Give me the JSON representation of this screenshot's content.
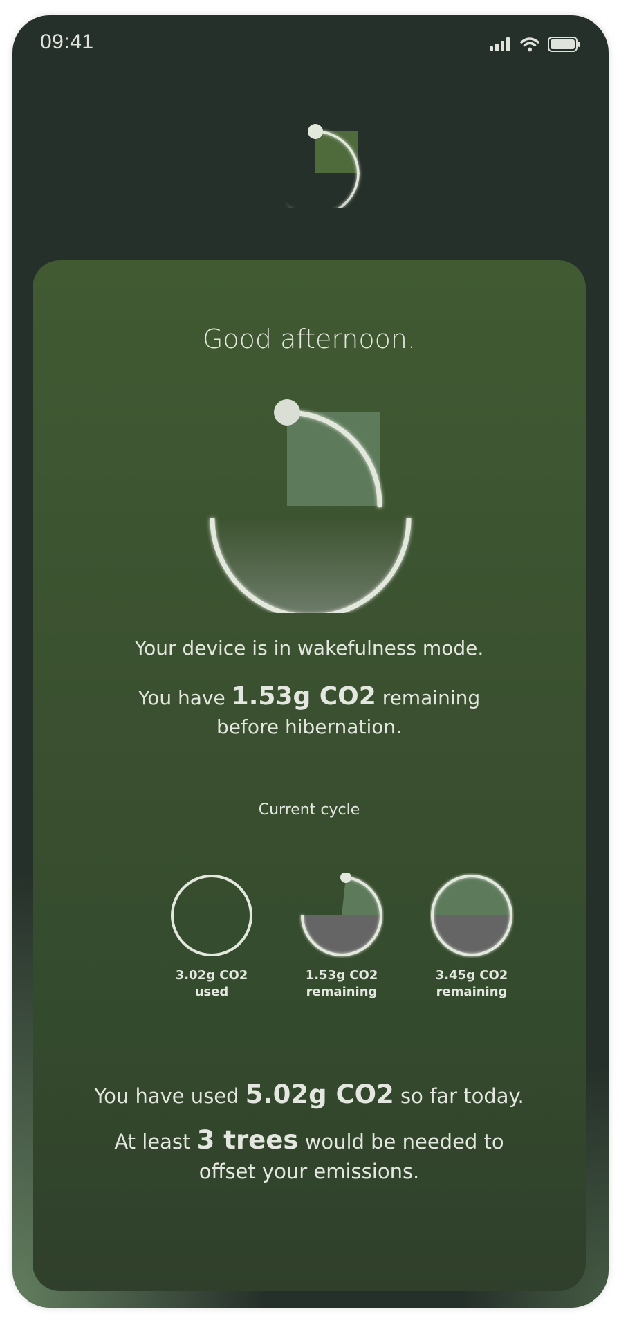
{
  "status_bar": {
    "time": "09:41"
  },
  "card": {
    "greeting": "Good afternoon.",
    "mode_line": "Your device is in wakefulness mode.",
    "remaining": {
      "prefix": "You have ",
      "amount": "1.53g CO2",
      "suffix": " remaining before hibernation."
    },
    "cycle_label": "Current cycle",
    "cycles": [
      {
        "amount": "3.02g CO2",
        "caption": "used",
        "fill_fraction": 0
      },
      {
        "amount": "1.53g CO2",
        "caption": "remaining",
        "fill_fraction": 0.75
      },
      {
        "amount": "3.45g CO2",
        "caption": "remaining",
        "fill_fraction": 1
      }
    ],
    "today": {
      "prefix": "You have used ",
      "amount": "5.02g CO2",
      "suffix": " so far today."
    },
    "trees": {
      "prefix": "At least ",
      "amount": "3 trees",
      "suffix": " would be needed to offset your emissions."
    }
  },
  "colors": {
    "background_dark": "#26302a",
    "card_green": "#3e5531",
    "ring": "#e3e8dd",
    "text": "#e4e7df"
  },
  "icons": [
    "cellular-signal-icon",
    "wifi-icon",
    "battery-icon",
    "logo-dial-icon"
  ]
}
